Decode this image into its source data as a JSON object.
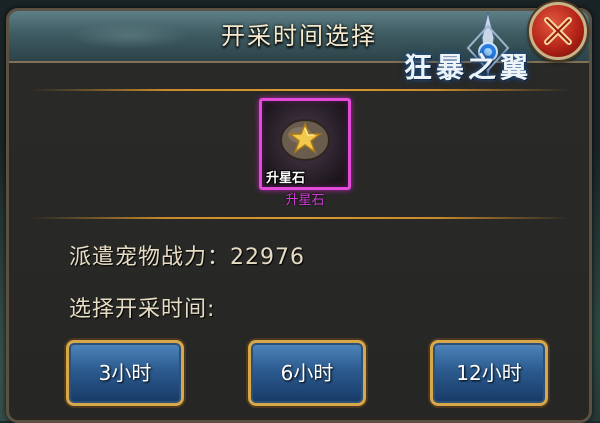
{
  "dialog": {
    "title": "开采时间选择"
  },
  "logo": {
    "text": "狂暴之翼"
  },
  "item": {
    "icon": "star-stone-icon",
    "count_label": "升星石",
    "name": "升星石",
    "rarity_color": "#e24ad8"
  },
  "info": {
    "power_label": "派遣宠物战力：",
    "power_value": "22976",
    "select_label": "选择开采时间:"
  },
  "time_options": [
    {
      "label": "3小时"
    },
    {
      "label": "6小时"
    },
    {
      "label": "12小时"
    }
  ],
  "colors": {
    "header": "#3e5c62",
    "accent_gold": "#d7a84a",
    "button_blue": "#2c5b8f",
    "close_red": "#b42418"
  }
}
